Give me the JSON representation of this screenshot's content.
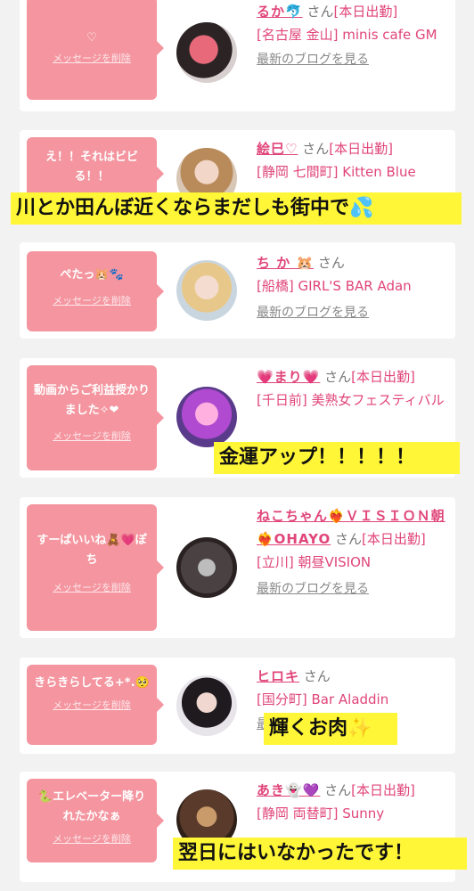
{
  "common": {
    "delete_label": "メッセージを削除",
    "san": "さん",
    "blog_label": "最新のブログを見る"
  },
  "cards": [
    {
      "message": "♡",
      "name": "るか🐬",
      "status": "[本日出勤]",
      "shop": "[名古屋 金山] minis cafe GM",
      "blog": true
    },
    {
      "message": "え！！それはビビる！！",
      "name": "絵巳♡",
      "status": "[本日出勤]",
      "shop": "[静岡 七間町] Kitten Blue",
      "blog": false
    },
    {
      "message": "ぺたっ🐹🐾",
      "name": "ち か 🐹",
      "status": "",
      "shop": "[船橋] GIRL'S BAR Adan",
      "blog": true
    },
    {
      "message": "動画からご利益授かりました✧❤",
      "name": "💗まり💗",
      "status": "[本日出勤]",
      "shop": "[千日前] 美熟女フェスティバル",
      "blog": false
    },
    {
      "message": "すーぱいいね🧸💗ぽち",
      "name": "ねこちゃん❤️‍🔥ＶＩＳＩＯＮ朝❤️‍🔥OHAYO",
      "status": "[本日出勤]",
      "shop": "[立川] 朝昼VISION",
      "blog": true
    },
    {
      "message": "きらきらしてる+*.🥺",
      "name": "ヒロキ",
      "status": "",
      "shop": "[国分町] Bar Aladdin",
      "blog": true
    },
    {
      "message": "🐍エレベーター降りれたかなぁ",
      "name": "あき👻💜",
      "status": "[本日出勤]",
      "shop": "[静岡 両替町] Sunny",
      "blog": false
    }
  ],
  "overlays": [
    "川とか田んぼ近くならまだしも街中で💦",
    "金運アップ！！！！！",
    "輝くお肉✨",
    "翌日にはいなかったです！"
  ]
}
